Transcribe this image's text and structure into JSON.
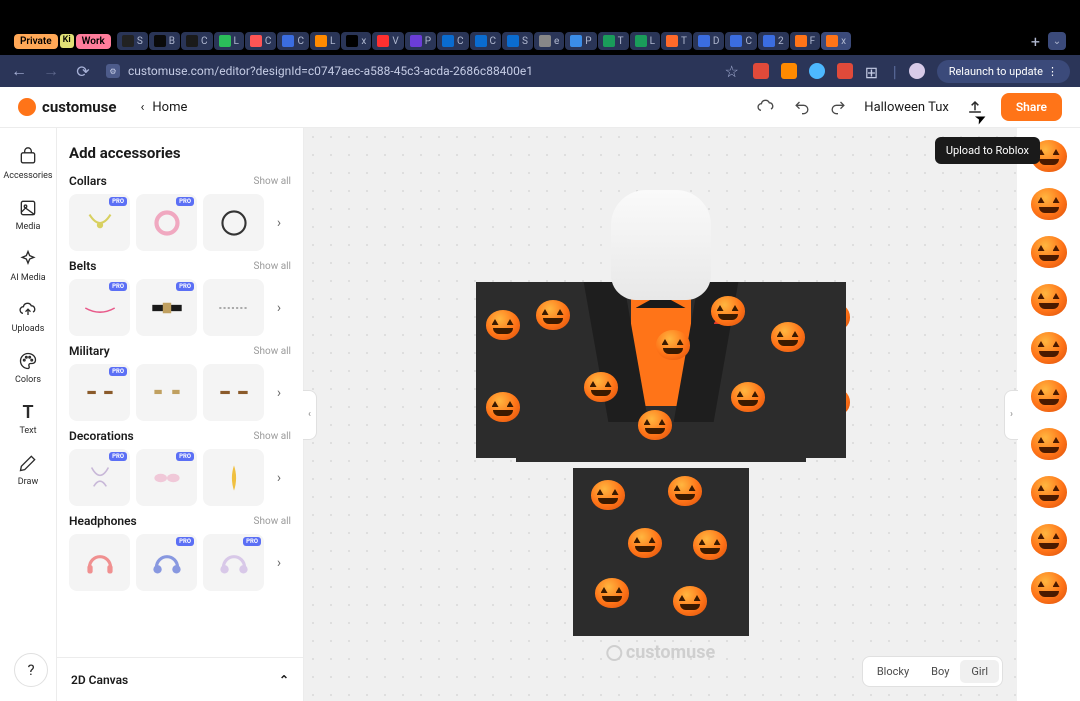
{
  "browser": {
    "badges": {
      "private": "Private",
      "ki": "Ki",
      "work": "Work"
    },
    "tabs": [
      {
        "icon_bg": "#222",
        "letter": "S"
      },
      {
        "icon_bg": "#0a0a0a",
        "letter": "B"
      },
      {
        "icon_bg": "#1a1a1a",
        "letter": "C"
      },
      {
        "icon_bg": "#2bbd5a",
        "letter": "L"
      },
      {
        "icon_bg": "#ff5555",
        "letter": "C"
      },
      {
        "icon_bg": "#3b6de0",
        "letter": "C"
      },
      {
        "icon_bg": "#ff8a00",
        "letter": "L"
      },
      {
        "icon_bg": "#000",
        "letter": "x"
      },
      {
        "icon_bg": "#ff3030",
        "letter": "V"
      },
      {
        "icon_bg": "#6b3dd8",
        "letter": "P"
      },
      {
        "icon_bg": "#0a6cd0",
        "letter": "C"
      },
      {
        "icon_bg": "#0a6cd0",
        "letter": "C"
      },
      {
        "icon_bg": "#0a6cd0",
        "letter": "S"
      },
      {
        "icon_bg": "#888",
        "letter": "e"
      },
      {
        "icon_bg": "#3b8de8",
        "letter": "P"
      },
      {
        "icon_bg": "#1a9c5a",
        "letter": "T"
      },
      {
        "icon_bg": "#1a9c5a",
        "letter": "L"
      },
      {
        "icon_bg": "#ff6a2a",
        "letter": "T"
      },
      {
        "icon_bg": "#3b6de0",
        "letter": "D"
      },
      {
        "icon_bg": "#3b6de0",
        "letter": "C"
      },
      {
        "icon_bg": "#3b6de0",
        "letter": "2"
      },
      {
        "icon_bg": "#ff7418",
        "letter": "F"
      },
      {
        "icon_bg": "#ff7418",
        "letter": "x",
        "active": true
      }
    ],
    "url": "customuse.com/editor?designId=c0747aec-a588-45c3-acda-2686c88400e1",
    "relaunch": "Relaunch to update"
  },
  "header": {
    "brand": "customuse",
    "home": "Home",
    "design_name": "Halloween Tux",
    "share": "Share",
    "tooltip": "Upload to Roblox"
  },
  "tools": [
    {
      "key": "accessories",
      "label": "Accessories"
    },
    {
      "key": "media",
      "label": "Media"
    },
    {
      "key": "aimedia",
      "label": "AI Media"
    },
    {
      "key": "uploads",
      "label": "Uploads"
    },
    {
      "key": "colors",
      "label": "Colors"
    },
    {
      "key": "text",
      "label": "Text"
    },
    {
      "key": "draw",
      "label": "Draw"
    }
  ],
  "panel": {
    "title": "Add accessories",
    "show_all": "Show all",
    "pro": "PRO",
    "categories": [
      {
        "name": "Collars",
        "items": [
          {
            "pro": true
          },
          {
            "pro": true
          },
          {
            "pro": false
          }
        ]
      },
      {
        "name": "Belts",
        "items": [
          {
            "pro": true
          },
          {
            "pro": true
          },
          {
            "pro": false
          }
        ]
      },
      {
        "name": "Military",
        "items": [
          {
            "pro": true
          },
          {
            "pro": false
          },
          {
            "pro": false
          }
        ]
      },
      {
        "name": "Decorations",
        "items": [
          {
            "pro": true
          },
          {
            "pro": true
          },
          {
            "pro": false
          }
        ]
      },
      {
        "name": "Headphones",
        "items": [
          {
            "pro": false
          },
          {
            "pro": true
          },
          {
            "pro": true
          }
        ]
      }
    ]
  },
  "canvas": {
    "watermark": "customuse",
    "body_types": [
      "Blocky",
      "Boy",
      "Girl"
    ],
    "body_active": "Girl",
    "panel2d": "2D Canvas",
    "help": "?"
  },
  "texture_strip_count": 10
}
